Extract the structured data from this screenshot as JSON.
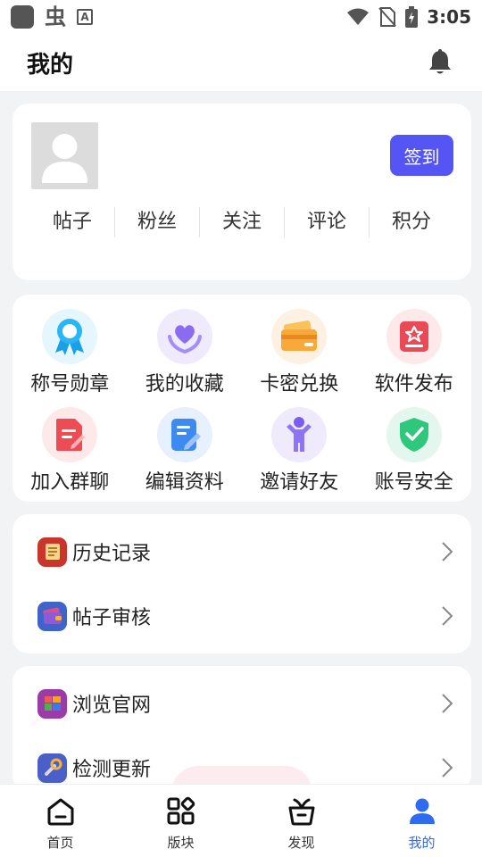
{
  "status_bar": {
    "time": "3:05"
  },
  "header": {
    "title": "我的"
  },
  "profile": {
    "checkin_label": "签到",
    "stats": [
      "帖子",
      "粉丝",
      "关注",
      "评论",
      "积分"
    ]
  },
  "features": [
    {
      "label": "称号勋章",
      "icon": "medal-icon"
    },
    {
      "label": "我的收藏",
      "icon": "heart-hands-icon"
    },
    {
      "label": "卡密兑换",
      "icon": "card-icon"
    },
    {
      "label": "软件发布",
      "icon": "publish-icon"
    },
    {
      "label": "加入群聊",
      "icon": "document-icon"
    },
    {
      "label": "编辑资料",
      "icon": "edit-icon"
    },
    {
      "label": "邀请好友",
      "icon": "person-icon"
    },
    {
      "label": "账号安全",
      "icon": "shield-check-icon"
    }
  ],
  "list_section_1": [
    {
      "label": "历史记录",
      "icon": "history-icon"
    },
    {
      "label": "帖子审核",
      "icon": "wallet-icon"
    }
  ],
  "list_section_2": [
    {
      "label": "浏览官网",
      "icon": "website-icon"
    },
    {
      "label": "检测更新",
      "icon": "update-icon"
    }
  ],
  "bottom_nav": [
    {
      "label": "首页",
      "icon": "home-icon"
    },
    {
      "label": "版块",
      "icon": "blocks-icon"
    },
    {
      "label": "发现",
      "icon": "discover-icon"
    },
    {
      "label": "我的",
      "icon": "user-icon",
      "active": true
    }
  ],
  "colors": {
    "accent": "#5555f5",
    "nav_active": "#2f6bf0",
    "background": "#f2f3f5"
  }
}
